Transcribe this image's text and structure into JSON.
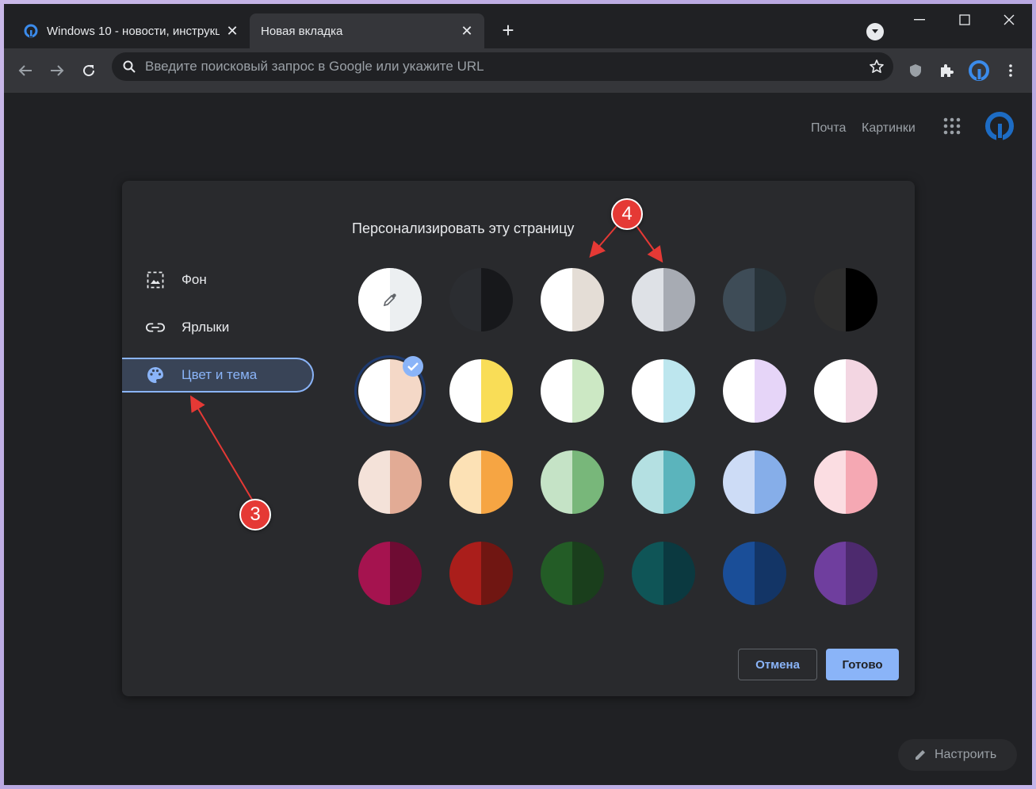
{
  "tabs": [
    {
      "title": "Windows 10 - новости, инструкции",
      "icon": "site-logo-icon",
      "active": false
    },
    {
      "title": "Новая вкладка",
      "icon": "",
      "active": true
    }
  ],
  "omnibox": {
    "placeholder": "Введите поисковый запрос в Google или укажите URL"
  },
  "top_links": {
    "mail": "Почта",
    "images": "Картинки"
  },
  "dialog": {
    "title": "Персонализировать эту страницу",
    "menu": [
      {
        "label": "Фон",
        "icon": "image-icon"
      },
      {
        "label": "Ярлыки",
        "icon": "link-icon"
      },
      {
        "label": "Цвет и тема",
        "icon": "palette-icon",
        "active": true
      }
    ],
    "swatches": [
      [
        [
          "#ffffff",
          "#eceff1"
        ],
        [
          "#2b2d31",
          "#17181b"
        ],
        [
          "#ffffff",
          "#e4ddd6"
        ],
        [
          "#dee1e6",
          "#a7abb3"
        ],
        [
          "#3e4c57",
          "#283339"
        ],
        [
          "#2e2e2e",
          "#000000"
        ]
      ],
      [
        [
          "#ffffff",
          "#f4d8c7"
        ],
        [
          "#ffffff",
          "#f9dd57"
        ],
        [
          "#ffffff",
          "#cce8c4"
        ],
        [
          "#ffffff",
          "#bde6ee"
        ],
        [
          "#ffffff",
          "#e6d5f8"
        ],
        [
          "#ffffff",
          "#f3d6e2"
        ]
      ],
      [
        [
          "#f4e2d9",
          "#e2ab95"
        ],
        [
          "#fce1b5",
          "#f6a543"
        ],
        [
          "#c5e3c6",
          "#78b77a"
        ],
        [
          "#b4e0e2",
          "#5bb4bc"
        ],
        [
          "#cddcf6",
          "#86aee9"
        ],
        [
          "#fbdde2",
          "#f5a8b3"
        ]
      ],
      [
        [
          "#a5134f",
          "#6e0c33"
        ],
        [
          "#aa1e1b",
          "#701612"
        ],
        [
          "#235c26",
          "#1a3e1c"
        ],
        [
          "#0f5557",
          "#0b3940"
        ],
        [
          "#1a4e98",
          "#133566"
        ],
        [
          "#6f3e9e",
          "#4d2a6e"
        ]
      ]
    ],
    "selected_swatch": "1-0",
    "cancel_label": "Отмена",
    "done_label": "Готово"
  },
  "customize_label": "Настроить",
  "annotations": {
    "badge3": "3",
    "badge4": "4"
  }
}
